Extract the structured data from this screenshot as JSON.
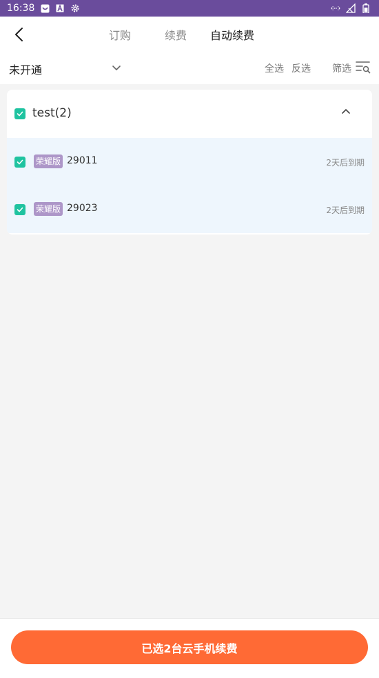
{
  "status_bar": {
    "time": "16:38",
    "color": "#6a4c9c"
  },
  "nav": {
    "tabs": [
      {
        "label": "订购",
        "active": false
      },
      {
        "label": "续费",
        "active": false
      },
      {
        "label": "自动续费",
        "active": true
      }
    ]
  },
  "filter_bar": {
    "status_value": "未开通",
    "select_all": "全选",
    "invert_select": "反选",
    "filter": "筛选"
  },
  "group": {
    "title": "test(2)",
    "checked": true,
    "devices": [
      {
        "badge": "荣耀版",
        "id": "29011",
        "expire": "2天后到期",
        "checked": true
      },
      {
        "badge": "荣耀版",
        "id": "29023",
        "expire": "2天后到期",
        "checked": true
      }
    ]
  },
  "bottom": {
    "button_label": "已选2台云手机续费",
    "accent": "#ff6a35"
  }
}
